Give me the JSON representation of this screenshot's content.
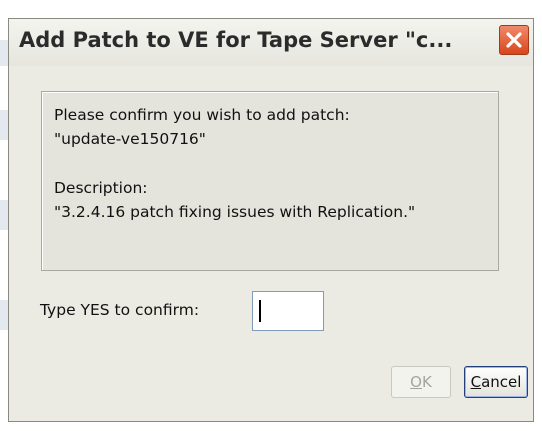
{
  "window": {
    "title": "Add Patch to VE for Tape Server \"c...",
    "close_icon": "close-icon"
  },
  "message": {
    "line1": "Please confirm you wish to add patch:",
    "line2": "\"update-ve150716\"",
    "line3": "Description:",
    "line4": "\"3.2.4.16 patch fixing issues with Replication.\""
  },
  "confirm": {
    "label": "Type YES to confirm:",
    "value": ""
  },
  "buttons": {
    "ok_mnemonic": "O",
    "ok_rest": "K",
    "cancel_mnemonic": "C",
    "cancel_rest": "ancel"
  },
  "colors": {
    "close_button": "#d8461c",
    "dialog_bg": "#ebebe4",
    "default_button_border": "#24407a"
  }
}
